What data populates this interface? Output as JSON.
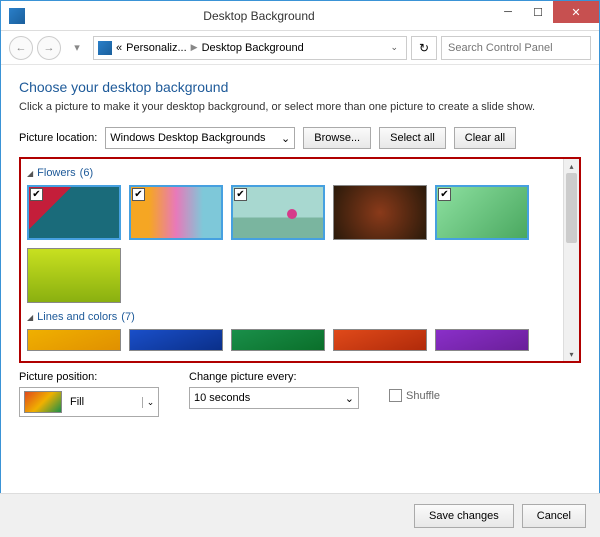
{
  "title": "Desktop Background",
  "breadcrumb": {
    "a": "Personaliz...",
    "b": "Desktop Background"
  },
  "search": {
    "placeholder": "Search Control Panel"
  },
  "heading": "Choose your desktop background",
  "subhead": "Click a picture to make it your desktop background, or select more than one picture to create a slide show.",
  "loc": {
    "label": "Picture location:",
    "value": "Windows Desktop Backgrounds"
  },
  "buttons": {
    "browse": "Browse...",
    "selectall": "Select all",
    "clearall": "Clear all",
    "save": "Save changes",
    "cancel": "Cancel"
  },
  "categories": {
    "flowers": {
      "name": "Flowers",
      "count": 6
    },
    "lines": {
      "name": "Lines and colors",
      "count": 7
    }
  },
  "footer": {
    "pos_label": "Picture position:",
    "pos_value": "Fill",
    "change_label": "Change picture every:",
    "change_value": "10 seconds",
    "shuffle": "Shuffle"
  }
}
